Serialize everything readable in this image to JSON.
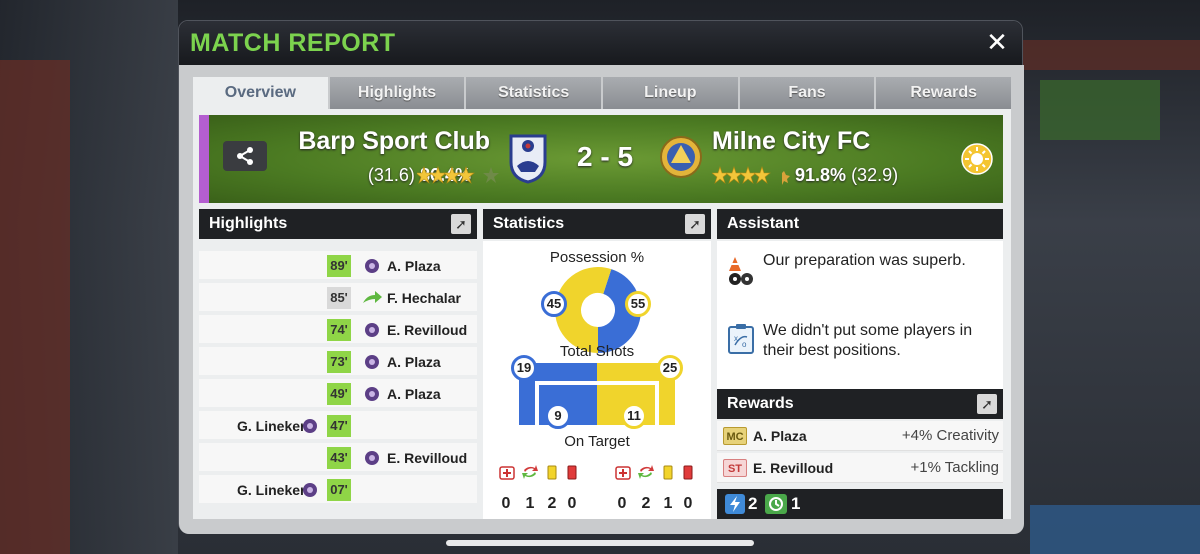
{
  "header": {
    "title": "MATCH REPORT",
    "close_label": "✕"
  },
  "tabs": [
    {
      "label": "Overview",
      "active": true
    },
    {
      "label": "Highlights",
      "active": false
    },
    {
      "label": "Statistics",
      "active": false
    },
    {
      "label": "Lineup",
      "active": false
    },
    {
      "label": "Fans",
      "active": false
    },
    {
      "label": "Rewards",
      "active": false
    }
  ],
  "match": {
    "home": {
      "name": "Barp Sport Club",
      "rating_avg": "(31.6)",
      "rating_pct": "86.4%",
      "stars": 4.5
    },
    "away": {
      "name": "Milne City FC",
      "rating_avg": "(32.9)",
      "rating_pct": "91.8%",
      "stars": 4.5
    },
    "score": "2 - 5",
    "weather_icon": "sun-icon",
    "accent_color": "#b45ed0"
  },
  "highlights": {
    "title": "Highlights",
    "events": [
      {
        "minute": "89'",
        "side": "away",
        "type": "goal",
        "player": "A. Plaza"
      },
      {
        "minute": "85'",
        "side": "away",
        "type": "substitution",
        "player": "F. Hechalar"
      },
      {
        "minute": "74'",
        "side": "away",
        "type": "goal",
        "player": "E. Revilloud"
      },
      {
        "minute": "73'",
        "side": "away",
        "type": "goal",
        "player": "A. Plaza"
      },
      {
        "minute": "49'",
        "side": "away",
        "type": "goal",
        "player": "A. Plaza"
      },
      {
        "minute": "47'",
        "side": "home",
        "type": "goal",
        "player": "G. Lineker"
      },
      {
        "minute": "43'",
        "side": "away",
        "type": "goal",
        "player": "E. Revilloud"
      },
      {
        "minute": "07'",
        "side": "home",
        "type": "goal",
        "player": "G. Lineker"
      }
    ]
  },
  "statistics": {
    "title": "Statistics",
    "possession_label": "Possession %",
    "possession": {
      "home": 45,
      "away": 55
    },
    "shots_label": "Total Shots",
    "shots": {
      "home": 19,
      "away": 25
    },
    "on_target_label": "On Target",
    "on_target": {
      "home": 9,
      "away": 11
    },
    "cards": {
      "home": {
        "injuries": "0",
        "subs": "1",
        "yellow": "2",
        "red": "0"
      },
      "away": {
        "injuries": "0",
        "subs": "2",
        "yellow": "1",
        "red": "0"
      }
    },
    "colors": {
      "home": "#3a6ed6",
      "away": "#f0d42c"
    }
  },
  "assistant": {
    "title": "Assistant",
    "messages": [
      {
        "icon": "training-cones-icon",
        "text": "Our preparation was superb."
      },
      {
        "icon": "tactics-board-icon",
        "text": "We didn't put some players in their best positions."
      }
    ]
  },
  "rewards": {
    "title": "Rewards",
    "items": [
      {
        "position": "MC",
        "player": "A. Plaza",
        "gain": "+4% Creativity"
      },
      {
        "position": "ST",
        "player": "E. Revilloud",
        "gain": "+1% Tackling"
      }
    ],
    "boosts": "2",
    "clock_boosts": "1"
  }
}
